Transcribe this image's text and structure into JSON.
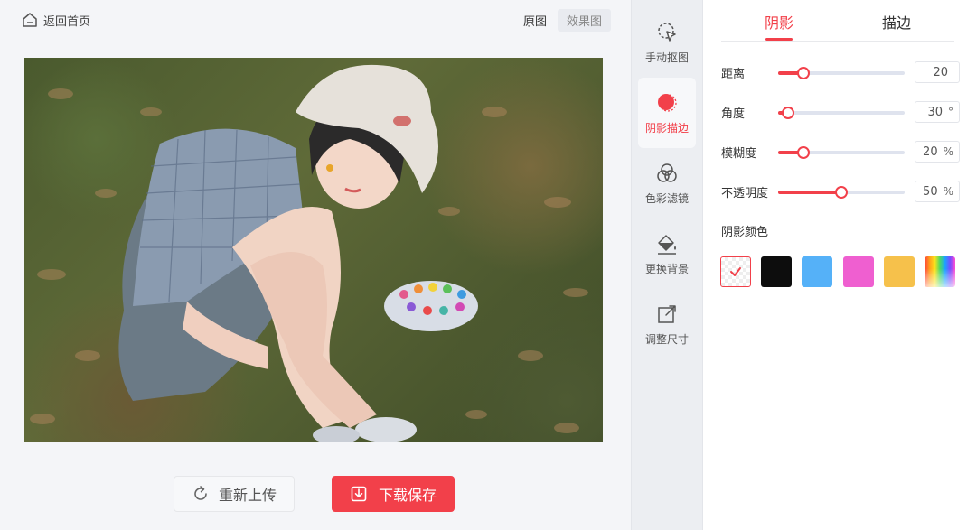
{
  "header": {
    "back_label": "返回首页",
    "view_original": "原图",
    "view_effect": "效果图"
  },
  "zoom_bar": {
    "icons": [
      "hand-icon",
      "zoom-out-icon",
      "zoom-in-icon",
      "fit-icon"
    ]
  },
  "actions": {
    "reupload": "重新上传",
    "download": "下载保存"
  },
  "tools": [
    {
      "label": "手动抠图",
      "icon": "cursor-lasso-icon",
      "active": false
    },
    {
      "label": "阴影描边",
      "icon": "shadow-circle-icon",
      "active": true
    },
    {
      "label": "色彩滤镜",
      "icon": "color-filter-icon",
      "active": false
    },
    {
      "label": "更换背景",
      "icon": "paint-bucket-icon",
      "active": false
    },
    {
      "label": "调整尺寸",
      "icon": "resize-icon",
      "active": false
    }
  ],
  "panel": {
    "tabs": [
      "阴影",
      "描边"
    ],
    "active_tab": "阴影",
    "sliders": [
      {
        "label": "距离",
        "value": "20",
        "unit": "",
        "level": 0.2
      },
      {
        "label": "角度",
        "value": "30",
        "unit": "°",
        "level": 0.08
      },
      {
        "label": "模糊度",
        "value": "20",
        "unit": "%",
        "level": 0.2
      },
      {
        "label": "不透明度",
        "value": "50",
        "unit": "%",
        "level": 0.5
      }
    ],
    "color_title": "阴影颜色",
    "colors": [
      {
        "name": "none",
        "hex": "#ffffff",
        "selected": true
      },
      {
        "name": "black",
        "hex": "#0d0d0d",
        "selected": false
      },
      {
        "name": "blue",
        "hex": "#55b1f8",
        "selected": false
      },
      {
        "name": "pink",
        "hex": "#ef5fd0",
        "selected": false
      },
      {
        "name": "yellow",
        "hex": "#f6c14b",
        "selected": false
      },
      {
        "name": "rainbow",
        "hex": "",
        "selected": false
      }
    ]
  },
  "colors": {
    "accent": "#f2404a",
    "panel_bg": "#ffffff",
    "page_bg": "#f4f5f8"
  }
}
